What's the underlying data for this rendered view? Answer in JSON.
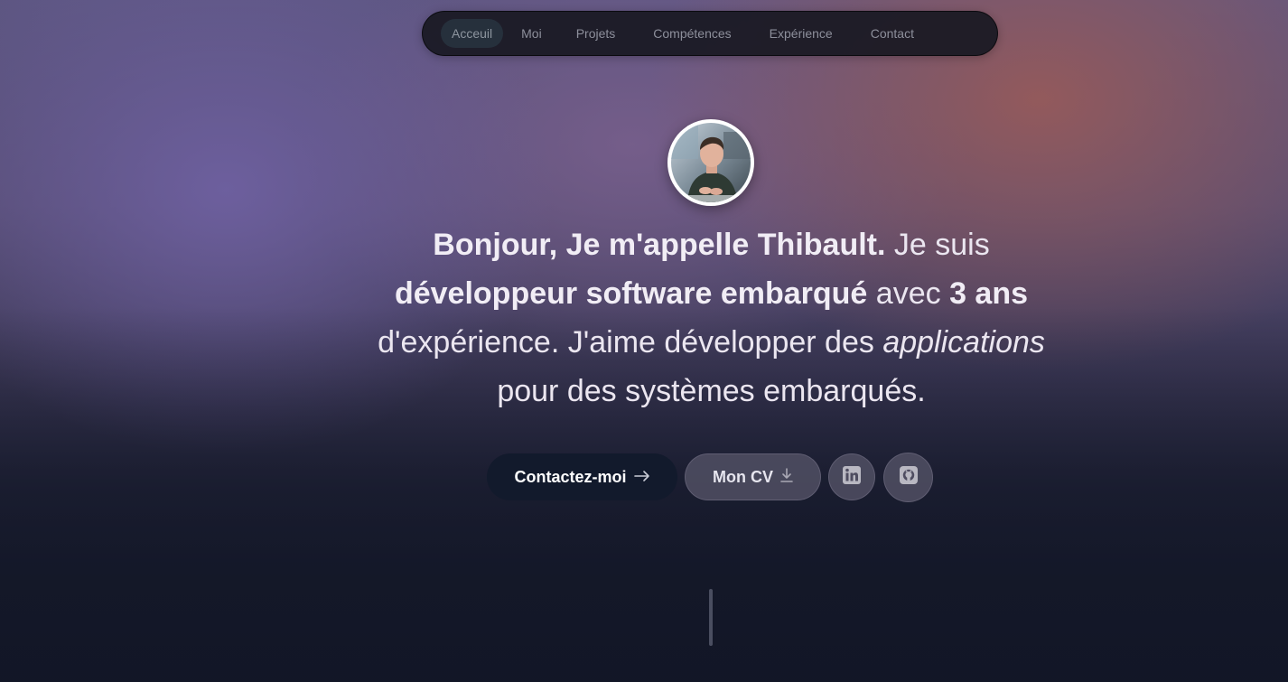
{
  "nav": {
    "items": [
      {
        "label": "Acceuil",
        "active": true
      },
      {
        "label": "Moi",
        "active": false
      },
      {
        "label": "Projets",
        "active": false
      },
      {
        "label": "Compétences",
        "active": false
      },
      {
        "label": "Expérience",
        "active": false
      },
      {
        "label": "Contact",
        "active": false
      }
    ]
  },
  "hero": {
    "part1_bold": "Bonjour, Je m'appelle Thibault.",
    "part2": " Je suis ",
    "part3_bold": "développeur software embarqué",
    "part4": " avec ",
    "part5_bold": "3 ans",
    "part6": " d'expérience. J'aime développer des ",
    "part7_italic": "applications",
    "part8": " pour des systèmes embarqués."
  },
  "buttons": {
    "contact_label": "Contactez-moi",
    "contact_icon": "arrow-right-icon",
    "cv_label": "Mon CV",
    "cv_icon": "download-icon",
    "linkedin_icon": "linkedin-icon",
    "github_icon": "github-icon"
  },
  "colors": {
    "nav_bg": "#181822",
    "nav_active_bg": "#26303c",
    "primary_button": "#121a2c",
    "secondary_button": "#4e4c60"
  }
}
